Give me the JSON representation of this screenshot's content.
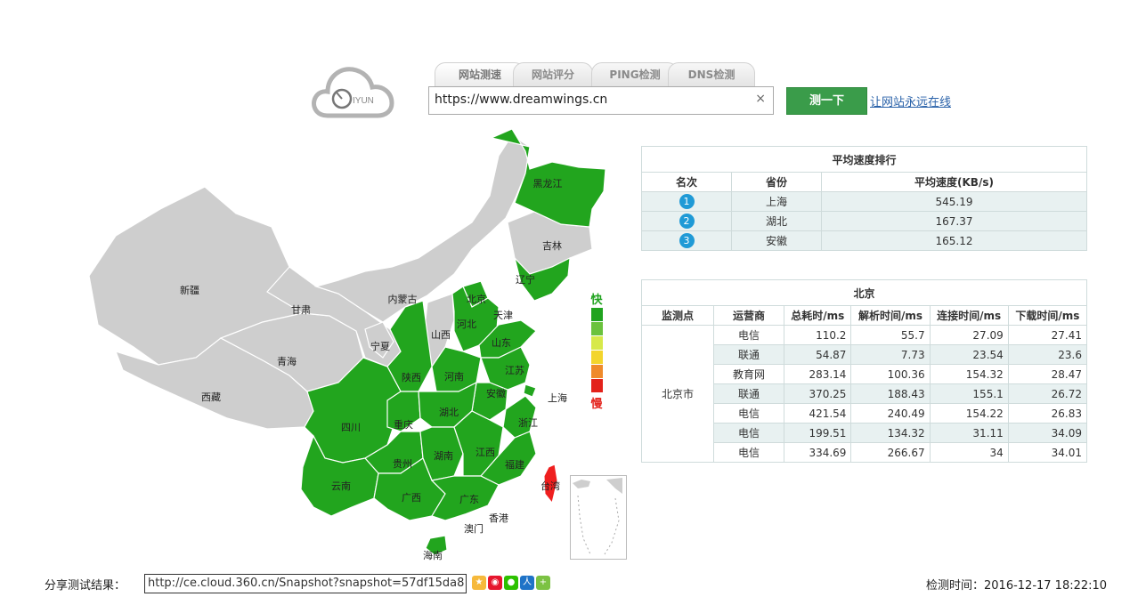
{
  "logo": {
    "text": "IYUN"
  },
  "tabs": [
    {
      "label": "网站测速"
    },
    {
      "label": "网站评分"
    },
    {
      "label": "PING检测"
    },
    {
      "label": "DNS检测"
    }
  ],
  "search": {
    "value": "https://www.dreamwings.cn",
    "clear": "×"
  },
  "test_button": "测一下",
  "online_link": "让网站永远在线",
  "legend": {
    "fast": "快",
    "slow": "慢",
    "colors": [
      "#20a31f",
      "#6ac23d",
      "#d7e94a",
      "#f3d52c",
      "#ef8a2b",
      "#e3221b"
    ]
  },
  "map": {
    "colors": {
      "fast": "#22a51e",
      "none": "#cecece",
      "slow": "#ef1f1f"
    },
    "labels": {
      "heilongjiang": "黑龙江",
      "jilin": "吉林",
      "liaoning": "辽宁",
      "neimenggu": "内蒙古",
      "xinjiang": "新疆",
      "gansu": "甘肃",
      "beijing": "北京",
      "tianjin": "天津",
      "hebei": "河北",
      "shanxi": "山西",
      "shandong": "山东",
      "ningxia": "宁夏",
      "qinghai": "青海",
      "shaanxi": "陕西",
      "henan": "河南",
      "jiangsu": "江苏",
      "anhui": "安徽",
      "shanghai": "上海",
      "xizang": "西藏",
      "sichuan": "四川",
      "chongqing": "重庆",
      "hubei": "湖北",
      "zhejiang": "浙江",
      "guizhou": "贵州",
      "hunan": "湖南",
      "jiangxi": "江西",
      "fujian": "福建",
      "taiwan": "台湾",
      "yunnan": "云南",
      "guangxi": "广西",
      "guangdong": "广东",
      "xianggang": "香港",
      "aomen": "澳门",
      "hainan": "海南"
    }
  },
  "ranking": {
    "title": "平均速度排行",
    "headers": [
      "名次",
      "省份",
      "平均速度(KB/s)"
    ],
    "rows": [
      {
        "rank": "1",
        "province": "上海",
        "speed": "545.19"
      },
      {
        "rank": "2",
        "province": "湖北",
        "speed": "167.37"
      },
      {
        "rank": "3",
        "province": "安徽",
        "speed": "165.12"
      }
    ]
  },
  "city": {
    "title": "北京",
    "headers": [
      "监测点",
      "运营商",
      "总耗时/ms",
      "解析时间/ms",
      "连接时间/ms",
      "下载时间/ms"
    ],
    "point": "北京市",
    "rows": [
      {
        "isp": "电信",
        "total": "110.2",
        "dns": "55.7",
        "connect": "27.09",
        "download": "27.41"
      },
      {
        "isp": "联通",
        "total": "54.87",
        "dns": "7.73",
        "connect": "23.54",
        "download": "23.6"
      },
      {
        "isp": "教育网",
        "total": "283.14",
        "dns": "100.36",
        "connect": "154.32",
        "download": "28.47"
      },
      {
        "isp": "联通",
        "total": "370.25",
        "dns": "188.43",
        "connect": "155.1",
        "download": "26.72"
      },
      {
        "isp": "电信",
        "total": "421.54",
        "dns": "240.49",
        "connect": "154.22",
        "download": "26.83"
      },
      {
        "isp": "电信",
        "total": "199.51",
        "dns": "134.32",
        "connect": "31.11",
        "download": "34.09"
      },
      {
        "isp": "电信",
        "total": "334.69",
        "dns": "266.67",
        "connect": "34",
        "download": "34.01"
      }
    ]
  },
  "share": {
    "label": "分享测试结果：",
    "url": "http://ce.cloud.360.cn/Snapshot?snapshot=57df15da8",
    "icons": [
      "qzone-icon",
      "weibo-icon",
      "wechat-icon",
      "renren-icon",
      "more-share-icon"
    ]
  },
  "detect_time": "检测时间：2016-12-17 18:22:10"
}
